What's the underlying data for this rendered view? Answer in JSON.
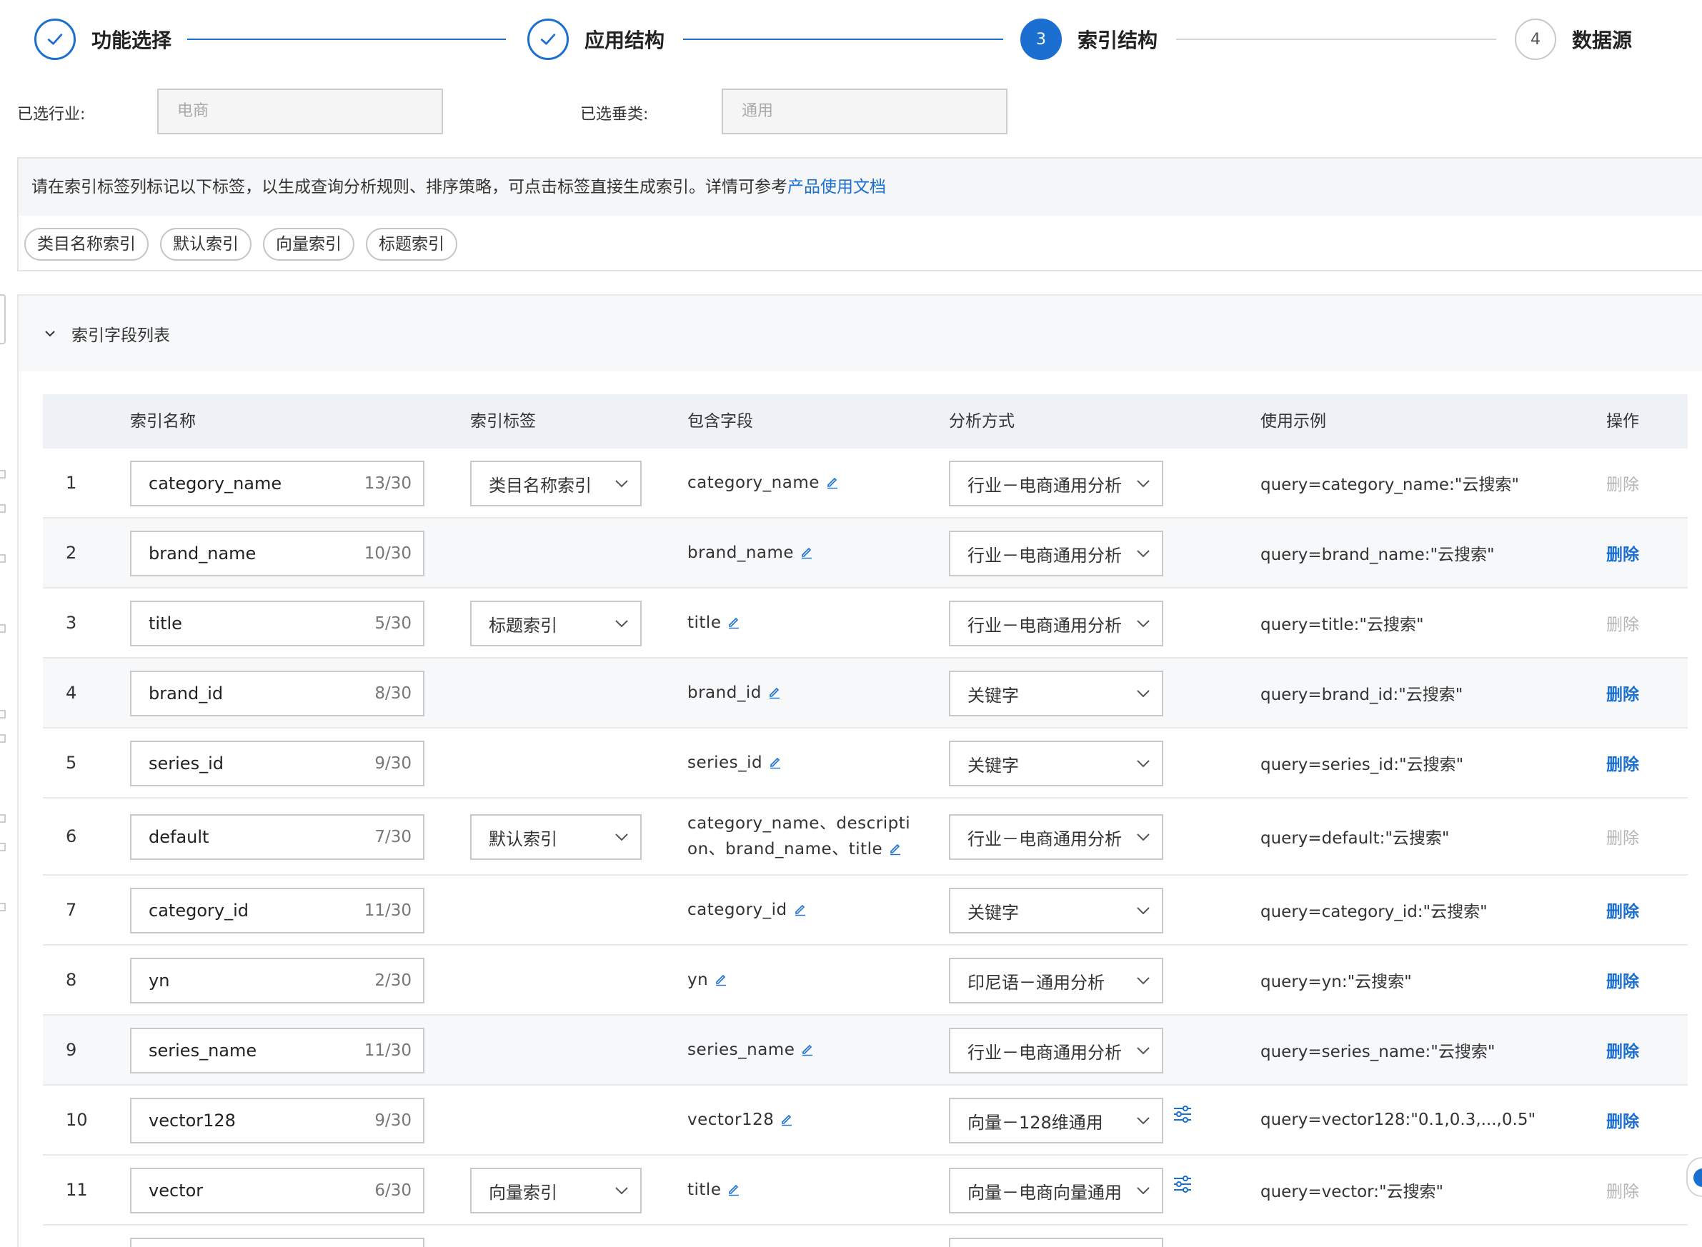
{
  "steps": [
    {
      "label": "功能选择",
      "state": "done",
      "num": ""
    },
    {
      "label": "应用结构",
      "state": "done",
      "num": ""
    },
    {
      "label": "索引结构",
      "state": "active",
      "num": "3"
    },
    {
      "label": "数据源",
      "state": "todo",
      "num": "4"
    }
  ],
  "selected": {
    "industry_label": "已选行业:",
    "industry_value": "电商",
    "category_label": "已选垂类:",
    "category_value": "通用"
  },
  "notice": {
    "text": "请在索引标签列标记以下标签，以生成查询分析规则、排序策略，可点击标签直接生成索引。详情可参考",
    "link": "产品使用文档",
    "tags": [
      "类目名称索引",
      "默认索引",
      "向量索引",
      "标题索引"
    ]
  },
  "panel": {
    "title": "索引字段列表"
  },
  "table": {
    "headers": {
      "name": "索引名称",
      "tag": "索引标签",
      "fields": "包含字段",
      "analysis": "分析方式",
      "example": "使用示例",
      "ops": "操作"
    },
    "rows": [
      {
        "idx": "1",
        "name": "category_name",
        "count": "13/30",
        "tag": "类目名称索引",
        "fields": "category_name",
        "analysis": "行业－电商通用分析",
        "tune": false,
        "example": "query=category_name:\"云搜索\"",
        "op": "删除",
        "op_enabled": false
      },
      {
        "idx": "2",
        "name": "brand_name",
        "count": "10/30",
        "tag": "",
        "fields": "brand_name",
        "analysis": "行业－电商通用分析",
        "tune": false,
        "example": "query=brand_name:\"云搜索\"",
        "op": "删除",
        "op_enabled": true
      },
      {
        "idx": "3",
        "name": "title",
        "count": "5/30",
        "tag": "标题索引",
        "fields": "title",
        "analysis": "行业－电商通用分析",
        "tune": false,
        "example": "query=title:\"云搜索\"",
        "op": "删除",
        "op_enabled": false
      },
      {
        "idx": "4",
        "name": "brand_id",
        "count": "8/30",
        "tag": "",
        "fields": "brand_id",
        "analysis": "关键字",
        "tune": false,
        "example": "query=brand_id:\"云搜索\"",
        "op": "删除",
        "op_enabled": true
      },
      {
        "idx": "5",
        "name": "series_id",
        "count": "9/30",
        "tag": "",
        "fields": "series_id",
        "analysis": "关键字",
        "tune": false,
        "example": "query=series_id:\"云搜索\"",
        "op": "删除",
        "op_enabled": true
      },
      {
        "idx": "6",
        "name": "default",
        "count": "7/30",
        "tag": "默认索引",
        "fields": "category_name、descripti on、brand_name、title",
        "analysis": "行业－电商通用分析",
        "tune": false,
        "example": "query=default:\"云搜索\"",
        "op": "删除",
        "op_enabled": false
      },
      {
        "idx": "7",
        "name": "category_id",
        "count": "11/30",
        "tag": "",
        "fields": "category_id",
        "analysis": "关键字",
        "tune": false,
        "example": "query=category_id:\"云搜索\"",
        "op": "删除",
        "op_enabled": true
      },
      {
        "idx": "8",
        "name": "yn",
        "count": "2/30",
        "tag": "",
        "fields": "yn",
        "analysis": "印尼语－通用分析",
        "tune": false,
        "example": "query=yn:\"云搜索\"",
        "op": "删除",
        "op_enabled": true
      },
      {
        "idx": "9",
        "name": "series_name",
        "count": "11/30",
        "tag": "",
        "fields": "series_name",
        "analysis": "行业－电商通用分析",
        "tune": false,
        "example": "query=series_name:\"云搜索\"",
        "op": "删除",
        "op_enabled": true
      },
      {
        "idx": "10",
        "name": "vector128",
        "count": "9/30",
        "tag": "",
        "fields": "vector128",
        "analysis": "向量－128维通用",
        "tune": true,
        "example": "query=vector128:\"0.1,0.3,...,0.5\"",
        "op": "删除",
        "op_enabled": true
      },
      {
        "idx": "11",
        "name": "vector",
        "count": "6/30",
        "tag": "向量索引",
        "fields": "title",
        "analysis": "向量－电商向量通用",
        "tune": true,
        "example": "query=vector:\"云搜索\"",
        "op": "删除",
        "op_enabled": false
      }
    ]
  },
  "colors": {
    "primary": "#1b6fd1",
    "disabled_text": "#b5b5b5",
    "header_bg": "#eef1f6",
    "alt_row_bg": "#f7f8fa"
  }
}
